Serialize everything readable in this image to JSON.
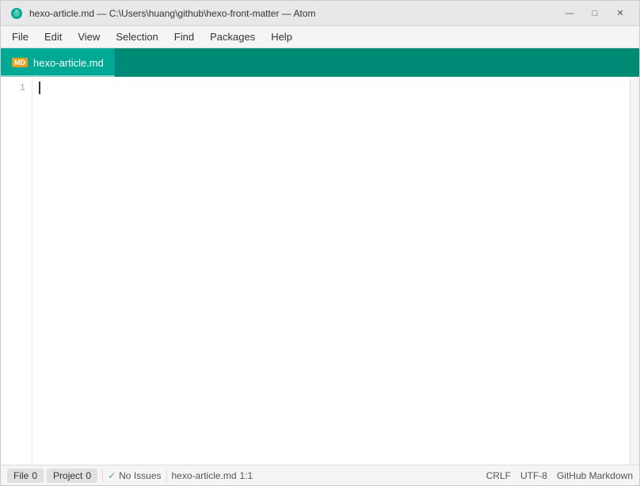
{
  "titlebar": {
    "title": "hexo-article.md — C:\\Users\\huang\\github\\hexo-front-matter — Atom"
  },
  "menubar": {
    "items": [
      "File",
      "Edit",
      "View",
      "Selection",
      "Find",
      "Packages",
      "Help"
    ]
  },
  "tab": {
    "icon_label": "MD",
    "filename": "hexo-article.md"
  },
  "gutter": {
    "line_numbers": [
      "1"
    ]
  },
  "editor": {
    "content": ""
  },
  "statusbar": {
    "file_btn": "File",
    "file_count": "0",
    "project_btn": "Project",
    "project_count": "0",
    "issues_icon": "✓",
    "issues_label": "No Issues",
    "filename": "hexo-article.md",
    "position": "1:1",
    "line_ending": "CRLF",
    "encoding": "UTF-8",
    "grammar": "GitHub Markdown"
  },
  "window_controls": {
    "minimize": "—",
    "maximize": "□",
    "close": "✕"
  }
}
